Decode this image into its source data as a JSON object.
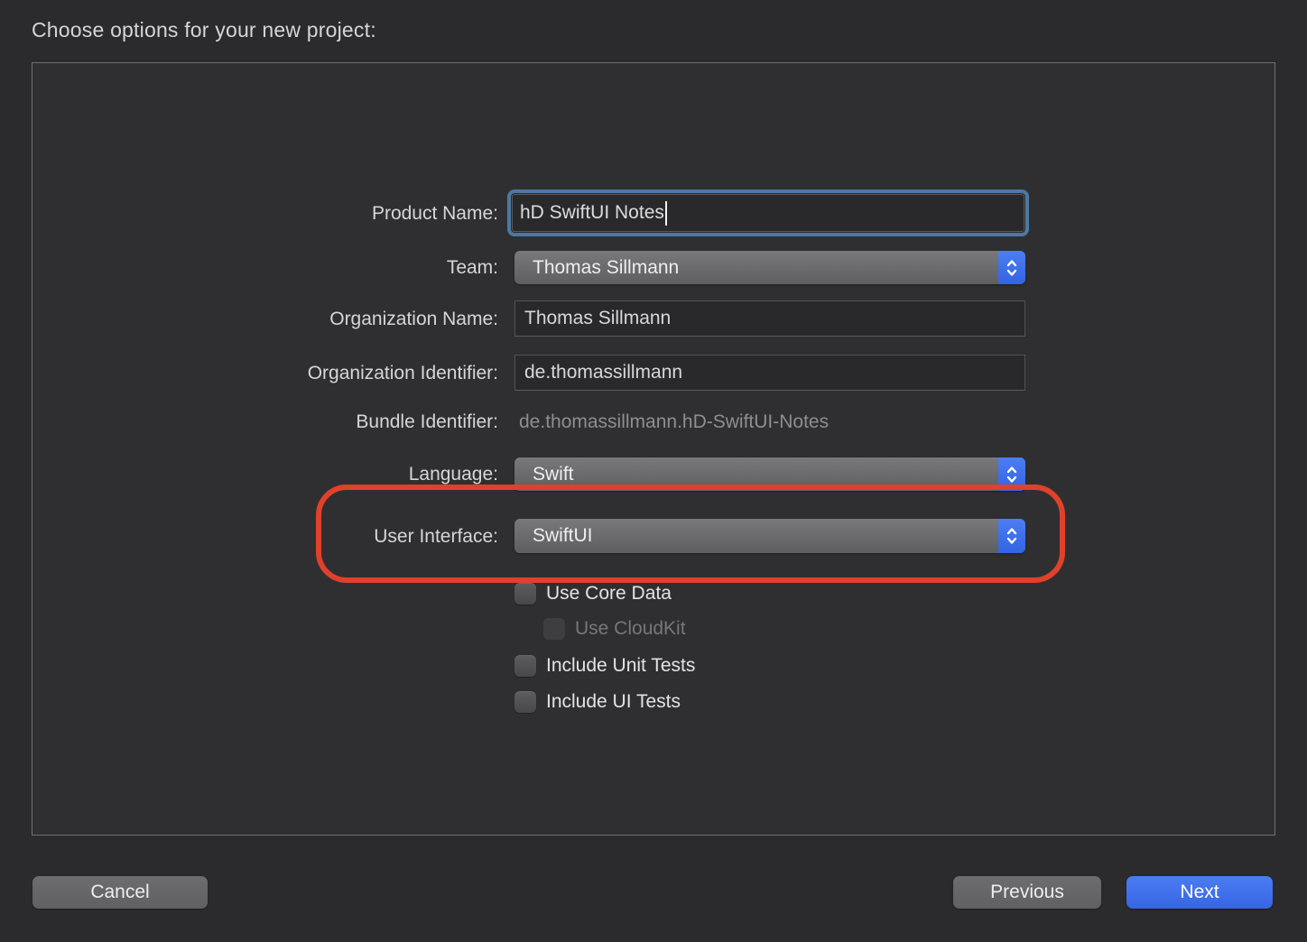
{
  "title": "Choose options for your new project:",
  "form": {
    "product_name": {
      "label": "Product Name:",
      "value": "hD SwiftUI Notes",
      "focused": true
    },
    "team": {
      "label": "Team:",
      "value": "Thomas Sillmann"
    },
    "organization_name": {
      "label": "Organization Name:",
      "value": "Thomas Sillmann"
    },
    "organization_identifier": {
      "label": "Organization Identifier:",
      "value": "de.thomassillmann"
    },
    "bundle_identifier": {
      "label": "Bundle Identifier:",
      "value": "de.thomassillmann.hD-SwiftUI-Notes"
    },
    "language": {
      "label": "Language:",
      "value": "Swift"
    },
    "user_interface": {
      "label": "User Interface:",
      "value": "SwiftUI"
    },
    "checkboxes": [
      {
        "label": "Use Core Data",
        "checked": false,
        "enabled": true,
        "indented": false
      },
      {
        "label": "Use CloudKit",
        "checked": false,
        "enabled": false,
        "indented": true
      },
      {
        "label": "Include Unit Tests",
        "checked": false,
        "enabled": true,
        "indented": false
      },
      {
        "label": "Include UI Tests",
        "checked": false,
        "enabled": true,
        "indented": false
      }
    ]
  },
  "annotation": {
    "type": "highlight-box",
    "target": "user-interface-row",
    "color": "#e0412a"
  },
  "buttons": {
    "cancel": "Cancel",
    "previous": "Previous",
    "next": "Next"
  },
  "colors": {
    "background": "#2b2b2d",
    "focus_ring": "#4d79a1",
    "stepper_blue": "#3b6ee8",
    "next_button_blue": "#3d6fea",
    "annotation_red": "#e0412a"
  }
}
